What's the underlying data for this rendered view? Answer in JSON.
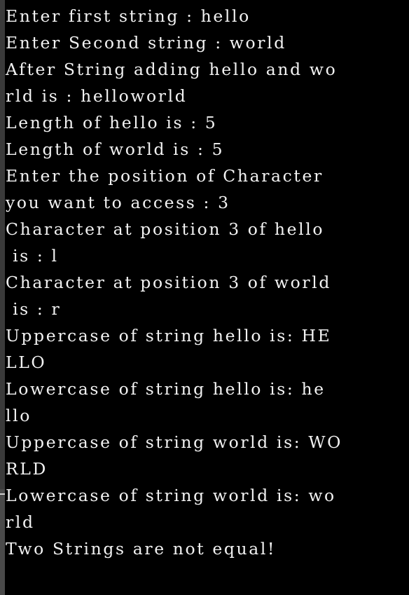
{
  "terminal": {
    "lines": [
      "Enter first string : hello",
      "Enter Second string : world",
      "After String adding hello and wo",
      "rld is : helloworld",
      "Length of hello is : 5",
      "Length of world is : 5",
      "Enter the position of Character",
      "you want to access : 3",
      "Character at position 3 of hello",
      " is : l",
      "Character at position 3 of world",
      " is : r",
      "Uppercase of string hello is: HE",
      "LLO",
      "Lowercase of string hello is: he",
      "llo",
      "Uppercase of string world is: WO",
      "RLD",
      "Lowercase of string world is: wo",
      "rld",
      "Two Strings are not equal!"
    ]
  },
  "colors": {
    "background": "#000000",
    "text": "#f2f2f2",
    "edge": "#3a3a3a"
  }
}
